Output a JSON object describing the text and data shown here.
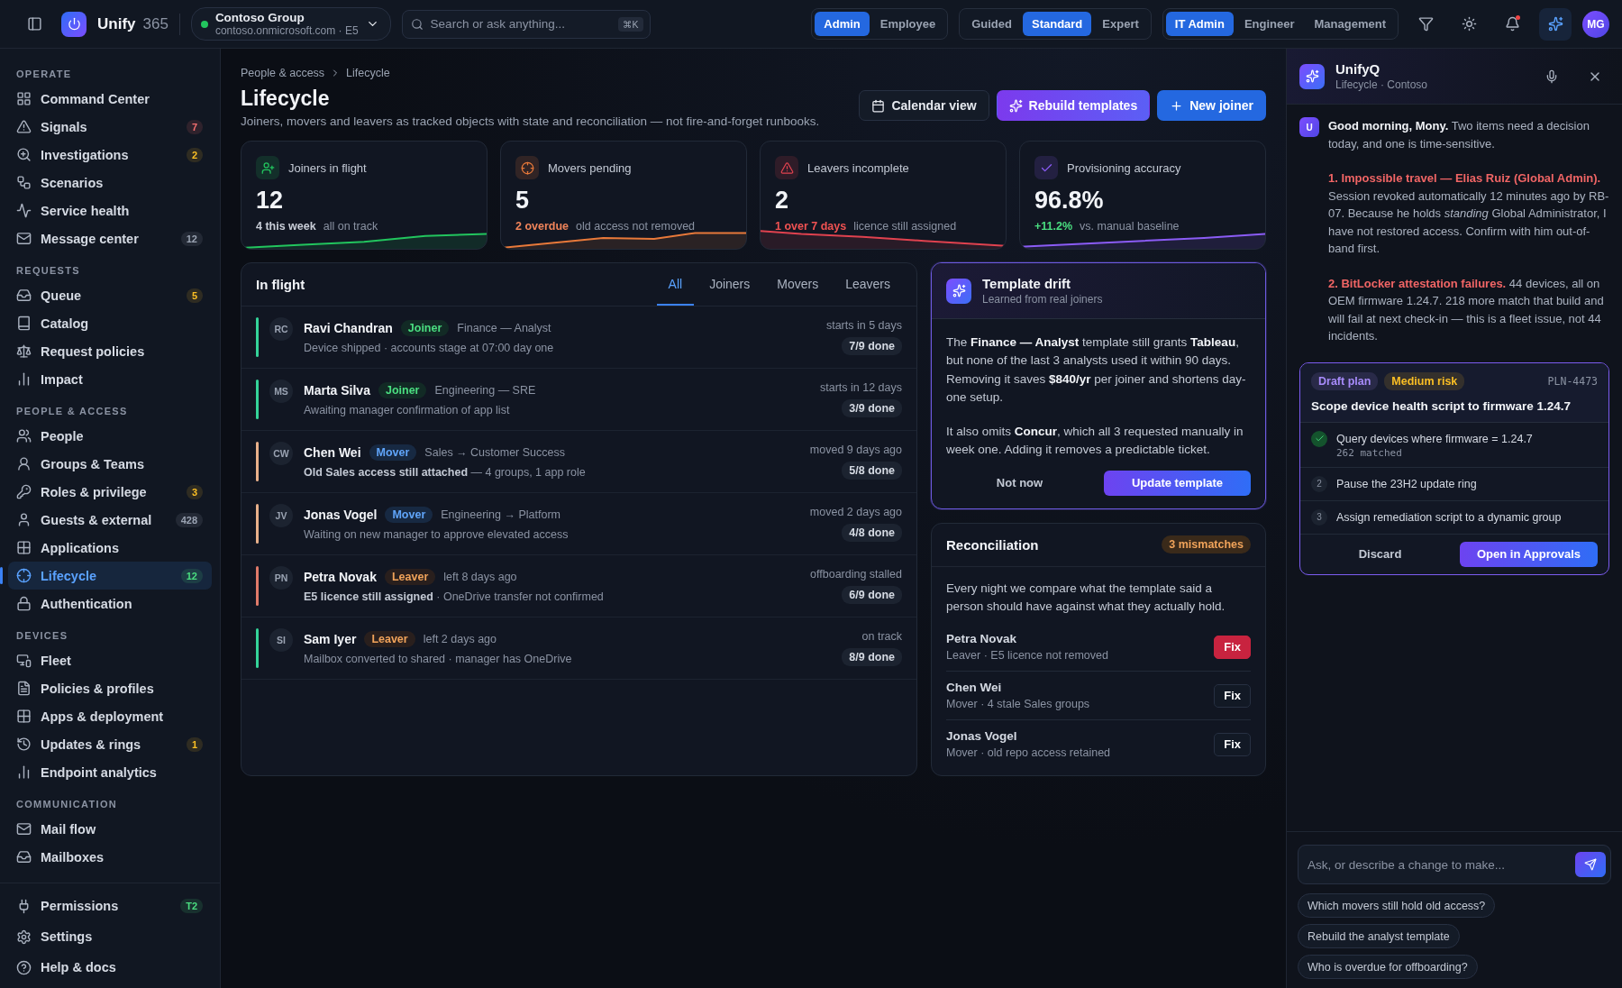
{
  "topbar": {
    "brand": "Unify",
    "brand_suffix": "365",
    "tenant": {
      "name": "Contoso Group",
      "domain": "contoso.onmicrosoft.com · E5",
      "color": "#22c55e"
    },
    "search": {
      "placeholder": "Search or ask anything...",
      "shortcut": "⌘K"
    },
    "toggle_groups": [
      [
        {
          "label": "Admin",
          "selected": true
        },
        {
          "label": "Employee",
          "selected": false
        }
      ],
      [
        {
          "label": "Guided",
          "selected": false
        },
        {
          "label": "Standard",
          "selected": true
        },
        {
          "label": "Expert",
          "selected": false
        }
      ],
      [
        {
          "label": "IT Admin",
          "selected": true
        },
        {
          "label": "Engineer",
          "selected": false
        },
        {
          "label": "Management",
          "selected": false
        }
      ]
    ],
    "notifications_unread": true,
    "avatar": "MG"
  },
  "sidebar": {
    "sections": [
      {
        "title": "OPERATE",
        "items": [
          {
            "label": "Command Center",
            "selected": false
          },
          {
            "label": "Signals",
            "badge": {
              "text": "7",
              "kind": "danger"
            },
            "selected": false
          },
          {
            "label": "Investigations",
            "badge": {
              "text": "2",
              "kind": "warning"
            },
            "selected": false
          },
          {
            "label": "Scenarios",
            "selected": false
          },
          {
            "label": "Service health",
            "selected": false
          },
          {
            "label": "Message center",
            "badge": {
              "text": "12",
              "kind": "neutral"
            },
            "selected": false
          }
        ]
      },
      {
        "title": "REQUESTS",
        "items": [
          {
            "label": "Queue",
            "badge": {
              "text": "5",
              "kind": "warning"
            },
            "selected": false
          },
          {
            "label": "Catalog",
            "selected": false
          },
          {
            "label": "Request policies",
            "selected": false
          },
          {
            "label": "Impact",
            "selected": false
          }
        ]
      },
      {
        "title": "PEOPLE & ACCESS",
        "items": [
          {
            "label": "People",
            "selected": false
          },
          {
            "label": "Groups & Teams",
            "selected": false
          },
          {
            "label": "Roles & privilege",
            "badge": {
              "text": "3",
              "kind": "warning"
            },
            "selected": false
          },
          {
            "label": "Guests & external",
            "badge": {
              "text": "428",
              "kind": "neutral"
            },
            "selected": false
          },
          {
            "label": "Applications",
            "selected": false
          },
          {
            "label": "Lifecycle",
            "badge": {
              "text": "12",
              "kind": "success"
            },
            "selected": true
          },
          {
            "label": "Authentication",
            "selected": false
          }
        ]
      },
      {
        "title": "DEVICES",
        "items": [
          {
            "label": "Fleet",
            "selected": false
          },
          {
            "label": "Policies & profiles",
            "selected": false
          },
          {
            "label": "Apps & deployment",
            "selected": false
          },
          {
            "label": "Updates & rings",
            "badge": {
              "text": "1",
              "kind": "warning"
            },
            "selected": false
          },
          {
            "label": "Endpoint analytics",
            "selected": false
          }
        ]
      },
      {
        "title": "COMMUNICATION",
        "items": [
          {
            "label": "Mail flow",
            "selected": false
          },
          {
            "label": "Mailboxes",
            "selected": false
          }
        ]
      }
    ],
    "footer": [
      {
        "label": "Permissions",
        "badge": {
          "text": "T2",
          "kind": "success"
        }
      },
      {
        "label": "Settings"
      },
      {
        "label": "Help & docs"
      }
    ]
  },
  "page": {
    "breadcrumb": [
      "People & access",
      "Lifecycle"
    ],
    "title": "Lifecycle",
    "description": "Joiners, movers and leavers as tracked objects with state and reconciliation — not fire-and-forget runbooks.",
    "actions": [
      {
        "label": "Calendar view",
        "kind": "secondary"
      },
      {
        "label": "Rebuild templates",
        "kind": "ai"
      },
      {
        "label": "New joiner",
        "kind": "primary"
      }
    ],
    "kpis": [
      {
        "label": "Joiners in flight",
        "value": "12",
        "highlight": {
          "text": "4 this week",
          "kind": "neutral"
        },
        "note": "all on track",
        "color": "#22c55e"
      },
      {
        "label": "Movers pending",
        "value": "5",
        "highlight": {
          "text": "2 overdue",
          "kind": "warning"
        },
        "note": "old access not removed",
        "color": "#e8793a"
      },
      {
        "label": "Leavers incomplete",
        "value": "2",
        "highlight": {
          "text": "1 over 7 days",
          "kind": "danger"
        },
        "note": "licence still assigned",
        "color": "#e0424f"
      },
      {
        "label": "Provisioning accuracy",
        "value": "96.8%",
        "highlight": {
          "text": "+11.2%",
          "kind": "success"
        },
        "note": "vs. manual baseline",
        "color": "#8b5cf6"
      }
    ],
    "in_flight": {
      "title": "In flight",
      "tabs": [
        {
          "label": "All",
          "selected": true
        },
        {
          "label": "Joiners",
          "selected": false
        },
        {
          "label": "Movers",
          "selected": false
        },
        {
          "label": "Leavers",
          "selected": false
        }
      ],
      "rows": [
        {
          "initials": "RC",
          "name": "Ravi Chandran",
          "kind": "joiner",
          "tag": "Joiner",
          "role": "Finance — Analyst",
          "detail": "Device shipped · accounts stage at 07:00 day one",
          "when": "starts in 5 days",
          "progress": "7/9 done",
          "color": "#34d399"
        },
        {
          "initials": "MS",
          "name": "Marta Silva",
          "kind": "joiner",
          "tag": "Joiner",
          "role": "Engineering — SRE",
          "detail": "Awaiting manager confirmation of app list",
          "when": "starts in 12 days",
          "progress": "3/9 done",
          "color": "#34d399"
        },
        {
          "initials": "CW",
          "name": "Chen Wei",
          "kind": "mover",
          "tag": "Mover",
          "role": "Sales → Customer Success",
          "detail": "**Old Sales access still attached** — 4 groups, 1 app role",
          "when": "moved 9 days ago",
          "progress": "5/8 done",
          "color": "#e8b08a"
        },
        {
          "initials": "JV",
          "name": "Jonas Vogel",
          "kind": "mover",
          "tag": "Mover",
          "role": "Engineering → Platform",
          "detail": "Waiting on new manager to approve elevated access",
          "when": "moved 2 days ago",
          "progress": "4/8 done",
          "color": "#e8b08a"
        },
        {
          "initials": "PN",
          "name": "Petra Novak",
          "kind": "leaver",
          "tag": "Leaver",
          "role": "left 8 days ago",
          "detail": "**E5 licence still assigned** · OneDrive transfer not confirmed",
          "when": "offboarding stalled",
          "progress": "6/9 done",
          "color": "#e07a6a"
        },
        {
          "initials": "SI",
          "name": "Sam Iyer",
          "kind": "leaver",
          "tag": "Leaver",
          "role": "left 2 days ago",
          "detail": "Mailbox converted to shared · manager has OneDrive",
          "when": "on track",
          "progress": "8/9 done",
          "color": "#34d399"
        }
      ]
    },
    "template_drift": {
      "title": "Template drift",
      "subtitle": "Learned from real joiners",
      "paragraphs": [
        "The **Finance — Analyst** template still grants **Tableau**, but none of the last 3 analysts used it within 90 days. Removing it saves **$840/yr** per joiner and shortens day-one setup.",
        "It also omits **Concur**, which all 3 requested manually in week one. Adding it removes a predictable ticket."
      ],
      "dismiss": "Not now",
      "confirm": "Update template"
    },
    "reconciliation": {
      "title": "Reconciliation",
      "badge": "3 mismatches",
      "intro": "Every night we compare what the template said a person should have against what they actually hold.",
      "items": [
        {
          "name": "Petra Novak",
          "detail": "Leaver · E5 licence not removed",
          "action": "Fix",
          "urgent": true
        },
        {
          "name": "Chen Wei",
          "detail": "Mover · 4 stale Sales groups",
          "action": "Fix",
          "urgent": false
        },
        {
          "name": "Jonas Vogel",
          "detail": "Mover · old repo access retained",
          "action": "Fix",
          "urgent": false
        }
      ]
    }
  },
  "assistant": {
    "title": "UnifyQ",
    "subtitle": "Lifecycle · Contoso",
    "avatar": "U",
    "message": [
      {
        "text": "**Good morning, Mony.** Two items need a decision today, and one is time-sensitive."
      },
      {
        "lead": "1. Impossible travel — Elias Ruiz (Global Admin).",
        "text": "Session revoked automatically 12 minutes ago by RB-07. Because he holds *standing* Global Administrator, I have not restored access. Confirm with him out-of-band first."
      },
      {
        "lead": "2. BitLocker attestation failures.",
        "text": "44 devices, all on OEM firmware 1.24.7. 218 more match that build and will fail at next check-in — this is a fleet issue, not 44 incidents."
      }
    ],
    "plan": {
      "tags": [
        {
          "label": "Draft plan",
          "kind": "accent"
        },
        {
          "label": "Medium risk",
          "kind": "warning"
        }
      ],
      "id": "PLN-4473",
      "title": "Scope device health script to firmware 1.24.7",
      "steps": [
        {
          "text": "Query devices where firmware = 1.24.7",
          "result": "262 matched",
          "done": true
        },
        {
          "number": "2",
          "text": "Pause the 23H2 update ring",
          "done": false
        },
        {
          "number": "3",
          "text": "Assign remediation script to a dynamic group",
          "done": false
        }
      ],
      "discard": "Discard",
      "confirm": "Open in Approvals"
    },
    "input": {
      "placeholder": "Ask, or describe a change to make..."
    },
    "suggestions": [
      "Which movers still hold old access?",
      "Rebuild the analyst template",
      "Who is overdue for offboarding?"
    ]
  }
}
